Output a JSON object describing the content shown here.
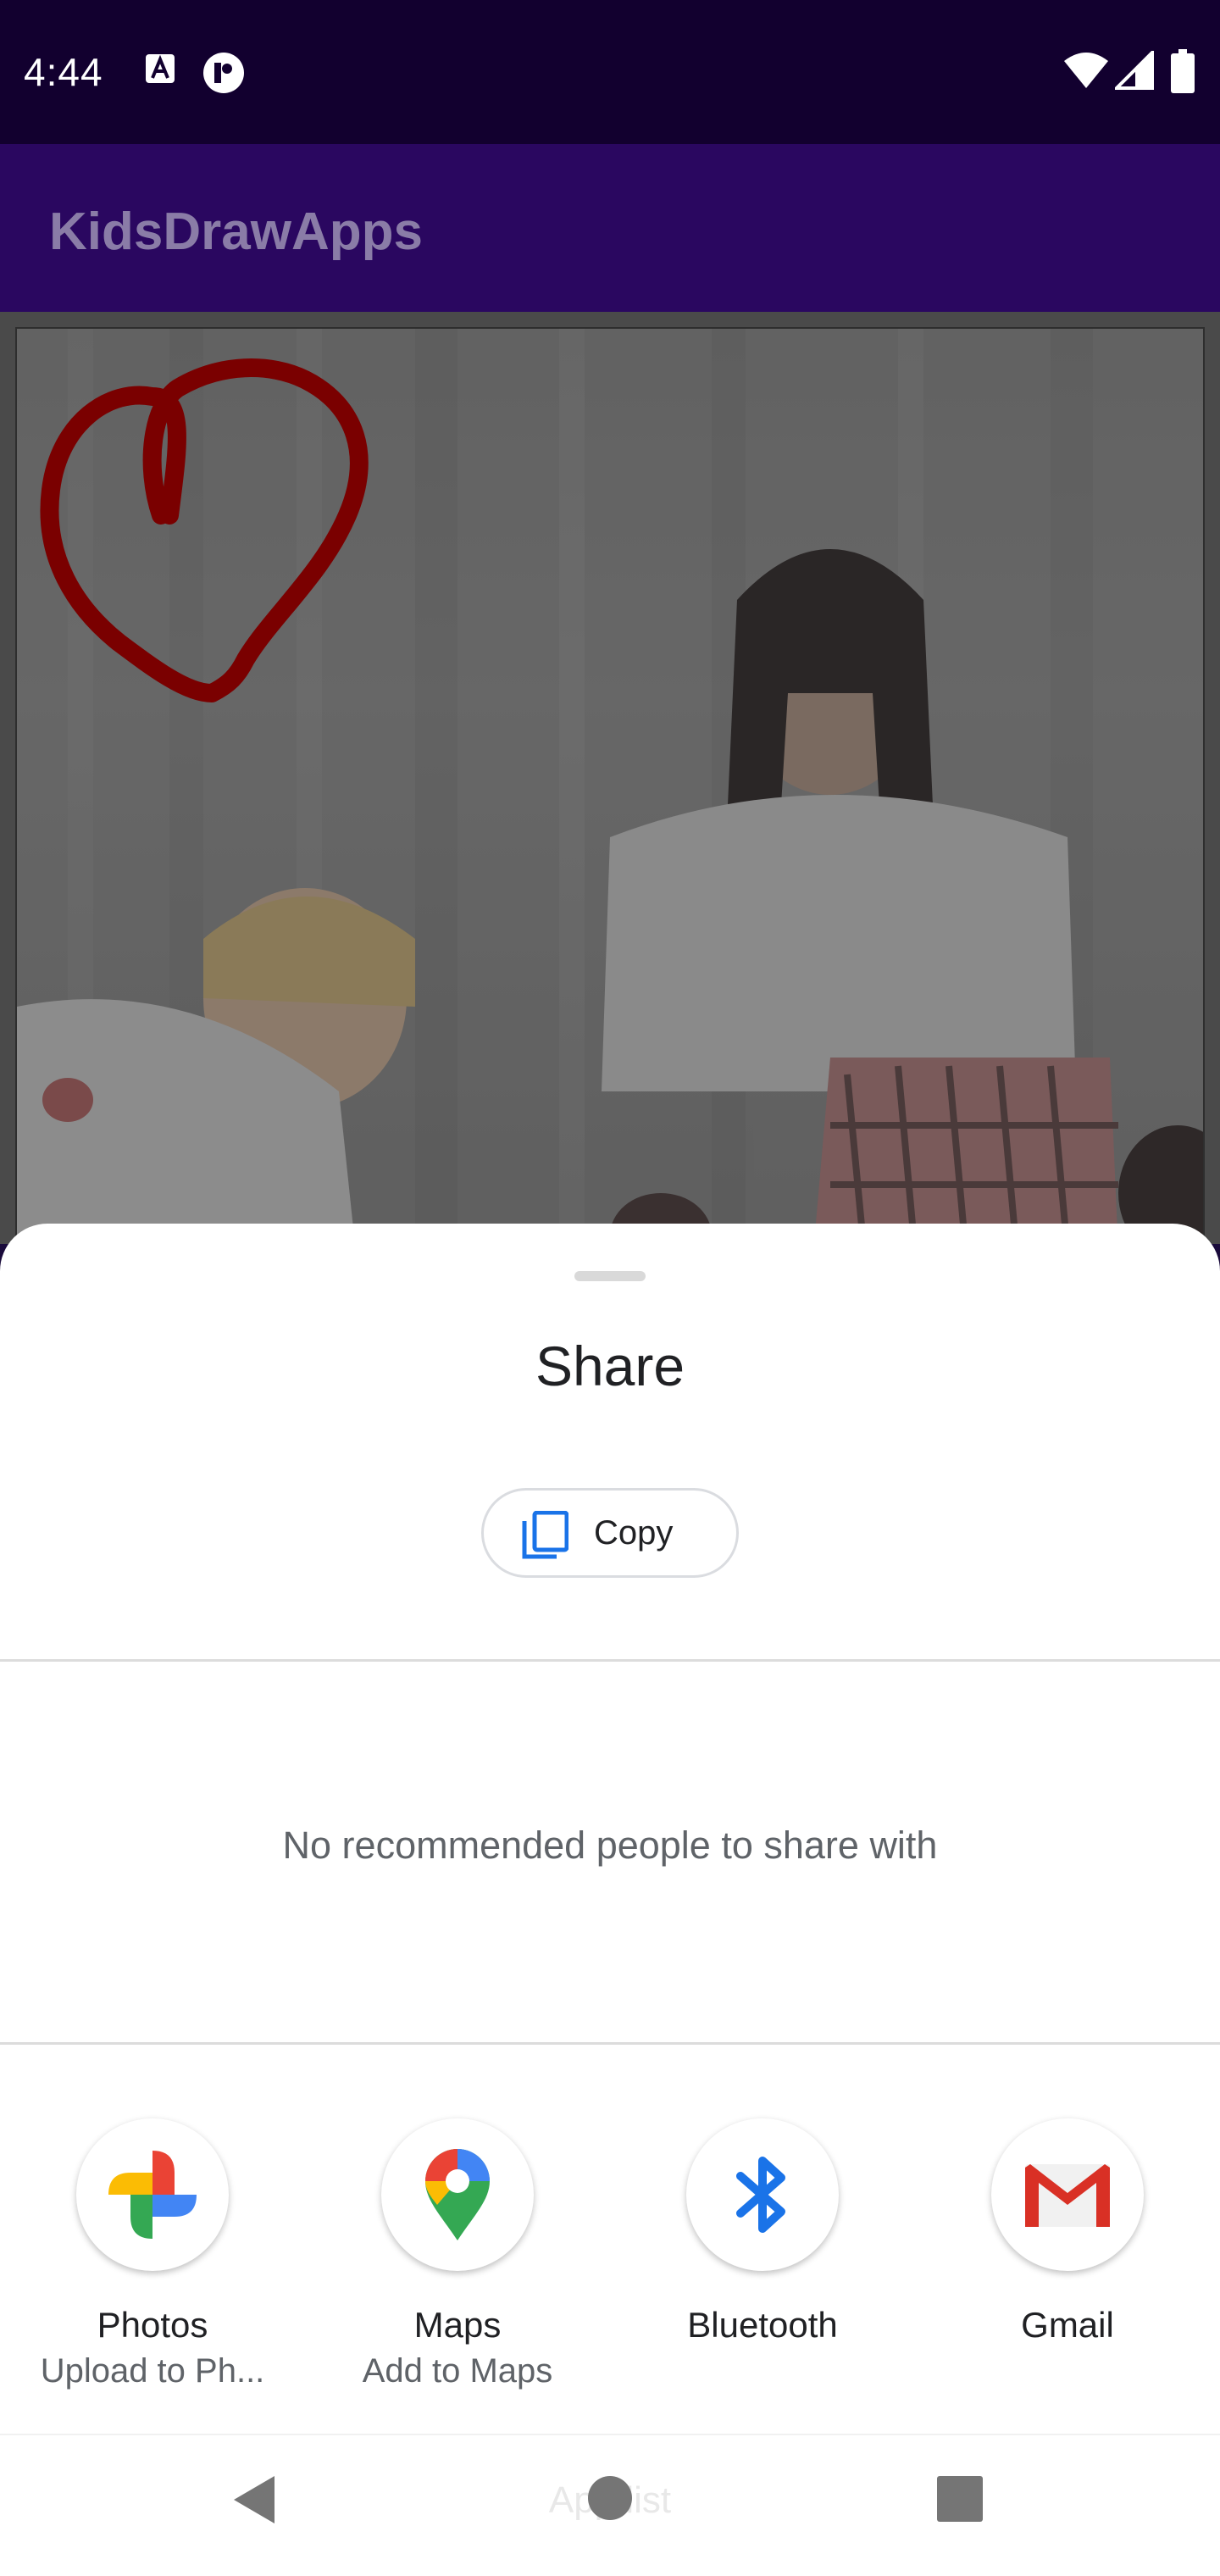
{
  "status_bar": {
    "time": "4:44",
    "icons": [
      "a-notification-icon",
      "dot-app-notification-icon",
      "wifi-icon",
      "cell-signal-icon",
      "battery-icon"
    ]
  },
  "app_bar": {
    "title": "KidsDrawApps"
  },
  "canvas": {
    "drawing": "heart-doodle",
    "stroke_color": "#7a0000"
  },
  "share_sheet": {
    "title": "Share",
    "copy_label": "Copy",
    "no_people_text": "No recommended people to share with",
    "targets": [
      {
        "label": "Photos",
        "sub": "Upload to Ph...",
        "icon": "google-photos-icon"
      },
      {
        "label": "Maps",
        "sub": "Add to Maps",
        "icon": "google-maps-icon"
      },
      {
        "label": "Bluetooth",
        "sub": "",
        "icon": "bluetooth-icon"
      },
      {
        "label": "Gmail",
        "sub": "",
        "icon": "gmail-icon"
      }
    ],
    "footer_hint": "App list"
  },
  "nav_bar": {
    "buttons": [
      "back-icon",
      "home-icon",
      "recents-icon"
    ]
  },
  "colors": {
    "status_bar": "#12002f",
    "app_bar": "#2a0760",
    "accent_blue": "#1a73e8"
  }
}
